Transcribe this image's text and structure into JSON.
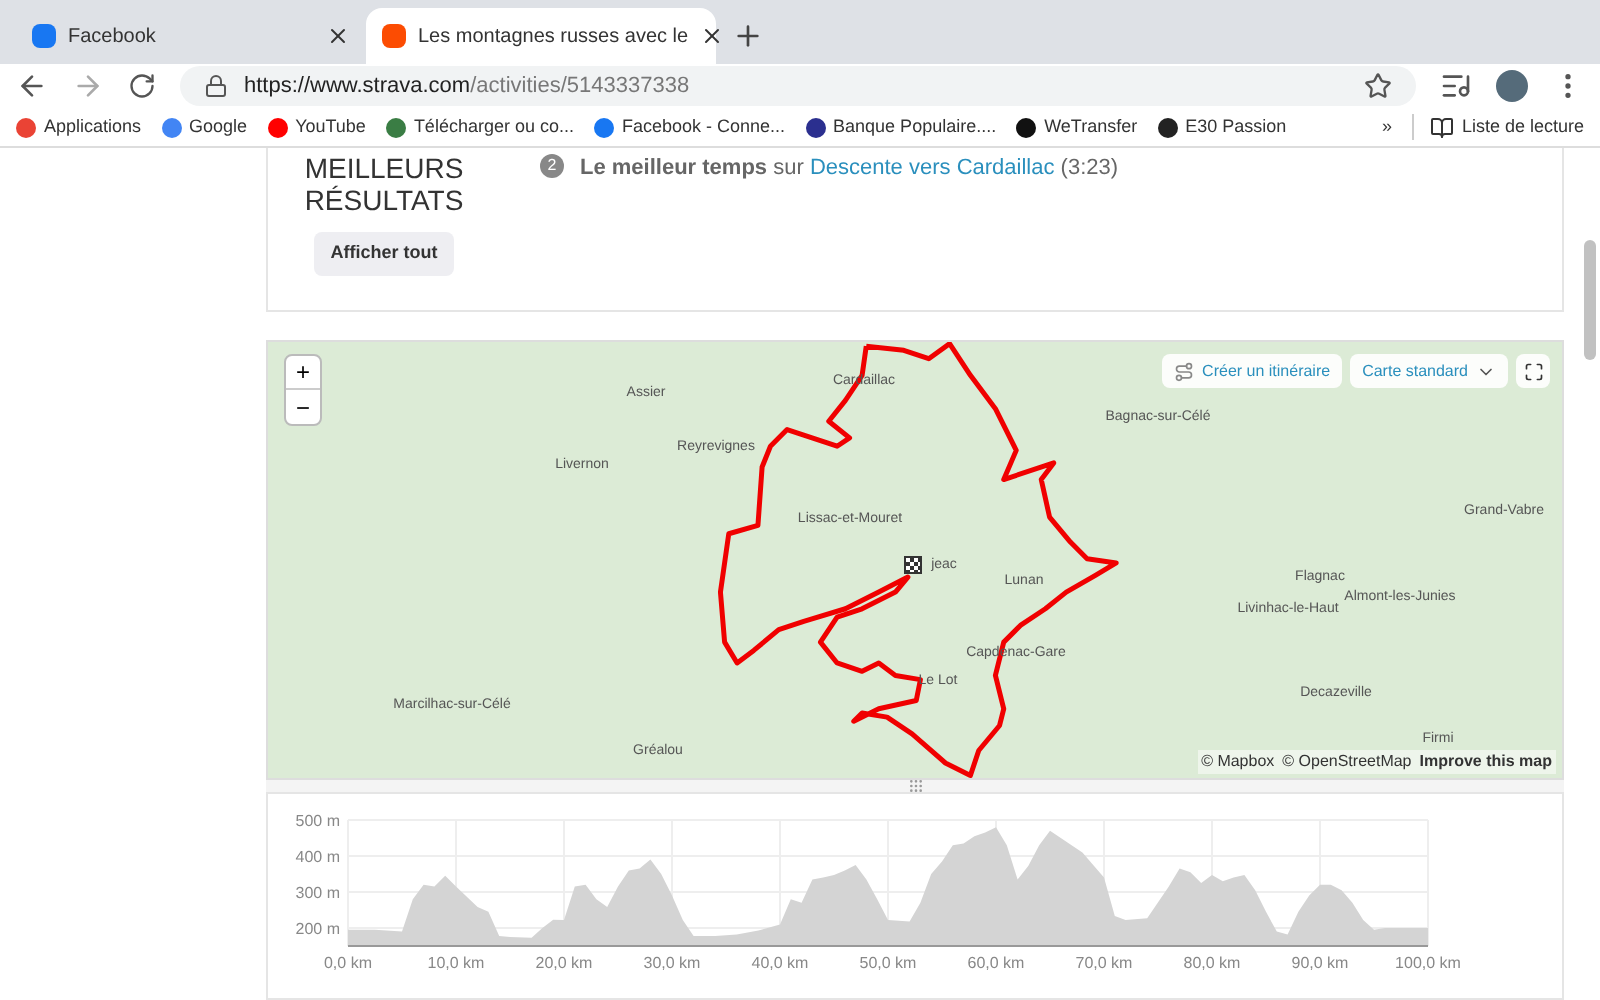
{
  "browser": {
    "tabs": [
      {
        "title": "Facebook",
        "selected": false
      },
      {
        "title": "Les montagnes russes avec le",
        "selected": true
      }
    ],
    "url": {
      "host": "https://www.strava.com",
      "path": "/activities/5143337338"
    },
    "bookmarks": [
      {
        "label": "Applications",
        "color": "#ea4335"
      },
      {
        "label": "Google",
        "color": "#4285f4"
      },
      {
        "label": "YouTube",
        "color": "#ff0000"
      },
      {
        "label": "Télécharger ou co...",
        "color": "#3a7d44"
      },
      {
        "label": "Facebook - Conne...",
        "color": "#1877f2"
      },
      {
        "label": "Banque Populaire....",
        "color": "#2b2f8f"
      },
      {
        "label": "WeTransfer",
        "color": "#111111"
      },
      {
        "label": "E30 Passion",
        "color": "#222222"
      }
    ],
    "more": "»",
    "reading_list": "Liste de lecture"
  },
  "best_results": {
    "title_lines": [
      "MEILLEURS",
      "RÉSULTATS"
    ],
    "show_all": "Afficher tout",
    "item": {
      "rank": "2",
      "text": "**Le meilleur temps** sur",
      "link": "Descente vers Cardaillac",
      "time": "(3:23)"
    }
  },
  "map": {
    "zoom_in": "+",
    "zoom_out": "−",
    "create_route": "Créer un itinéraire",
    "map_style": "Carte standard",
    "places": [
      {
        "name": "Cardaillac"
      },
      {
        "name": "Assier"
      },
      {
        "name": "Reyrevignes"
      },
      {
        "name": "Livernon"
      },
      {
        "name": "Lissac-et-Mouret"
      },
      {
        "name": "jeac"
      },
      {
        "name": "Lunan"
      },
      {
        "name": "Bagnac-sur-Célé"
      },
      {
        "name": "Grand-Vabre"
      },
      {
        "name": "Flagnac"
      },
      {
        "name": "Livinhac-le-Haut"
      },
      {
        "name": "Almont-les-Junies"
      },
      {
        "name": "Capdenac-Gare"
      },
      {
        "name": "Le Lot"
      },
      {
        "name": "Decazeville"
      },
      {
        "name": "Firmi"
      },
      {
        "name": "Marcilhac-sur-Célé"
      },
      {
        "name": "Gréalou"
      }
    ],
    "attribution": [
      "© Mapbox",
      "© OpenStreetMap",
      "Improve this map"
    ]
  },
  "elevation": {
    "chart_data": {
      "type": "area",
      "x": [
        0,
        2.5,
        5,
        6,
        7,
        8,
        9,
        10,
        12,
        13,
        14,
        15,
        17,
        18,
        19,
        20,
        21,
        22,
        23,
        24,
        25,
        26,
        27,
        28,
        29,
        30,
        31,
        32,
        34,
        36,
        38,
        40,
        41,
        42,
        43,
        44,
        45,
        46,
        47,
        48,
        49,
        50,
        52,
        53,
        54,
        55,
        56,
        57,
        58,
        59,
        60,
        61,
        62,
        63,
        64,
        65,
        66,
        68,
        70,
        71,
        72,
        74,
        76,
        77,
        78,
        79,
        80,
        81,
        82,
        83,
        84,
        85,
        86,
        87,
        88,
        89,
        90,
        91,
        92,
        93,
        94,
        95,
        96,
        98,
        100
      ],
      "grid": true,
      "series": [
        {
          "color": "#d4d4d4",
          "values": [
            195,
            195,
            190,
            280,
            320,
            315,
            345,
            315,
            258,
            245,
            178,
            175,
            173,
            200,
            223,
            222,
            315,
            320,
            280,
            258,
            315,
            360,
            365,
            390,
            350,
            290,
            222,
            178,
            178,
            182,
            193,
            210,
            280,
            270,
            335,
            340,
            347,
            360,
            375,
            335,
            280,
            222,
            218,
            270,
            350,
            385,
            430,
            435,
            455,
            465,
            480,
            430,
            335,
            373,
            430,
            470,
            450,
            410,
            340,
            233,
            222,
            227,
            315,
            365,
            355,
            325,
            347,
            330,
            340,
            347,
            305,
            245,
            190,
            182,
            245,
            290,
            320,
            320,
            305,
            270,
            222,
            195,
            200,
            200,
            200
          ]
        }
      ],
      "xlim": [
        0,
        100
      ],
      "ylim": [
        150,
        500
      ],
      "xticks": [
        {
          "value": 0,
          "label": "0,0 km"
        },
        {
          "value": 10,
          "label": "10,0 km"
        },
        {
          "value": 20,
          "label": "20,0 km"
        },
        {
          "value": 30,
          "label": "30,0 km"
        },
        {
          "value": 40,
          "label": "40,0 km"
        },
        {
          "value": 50,
          "label": "50,0 km"
        },
        {
          "value": 60,
          "label": "60,0 km"
        },
        {
          "value": 70,
          "label": "70,0 km"
        },
        {
          "value": 80,
          "label": "80,0 km"
        },
        {
          "value": 90,
          "label": "90,0 km"
        },
        {
          "value": 100,
          "label": "100,0 km"
        }
      ],
      "yticks": [
        {
          "value": 200,
          "label": "200 m"
        },
        {
          "value": 300,
          "label": "300 m"
        },
        {
          "value": 400,
          "label": "400 m"
        },
        {
          "value": 500,
          "label": "500 m"
        }
      ]
    }
  }
}
